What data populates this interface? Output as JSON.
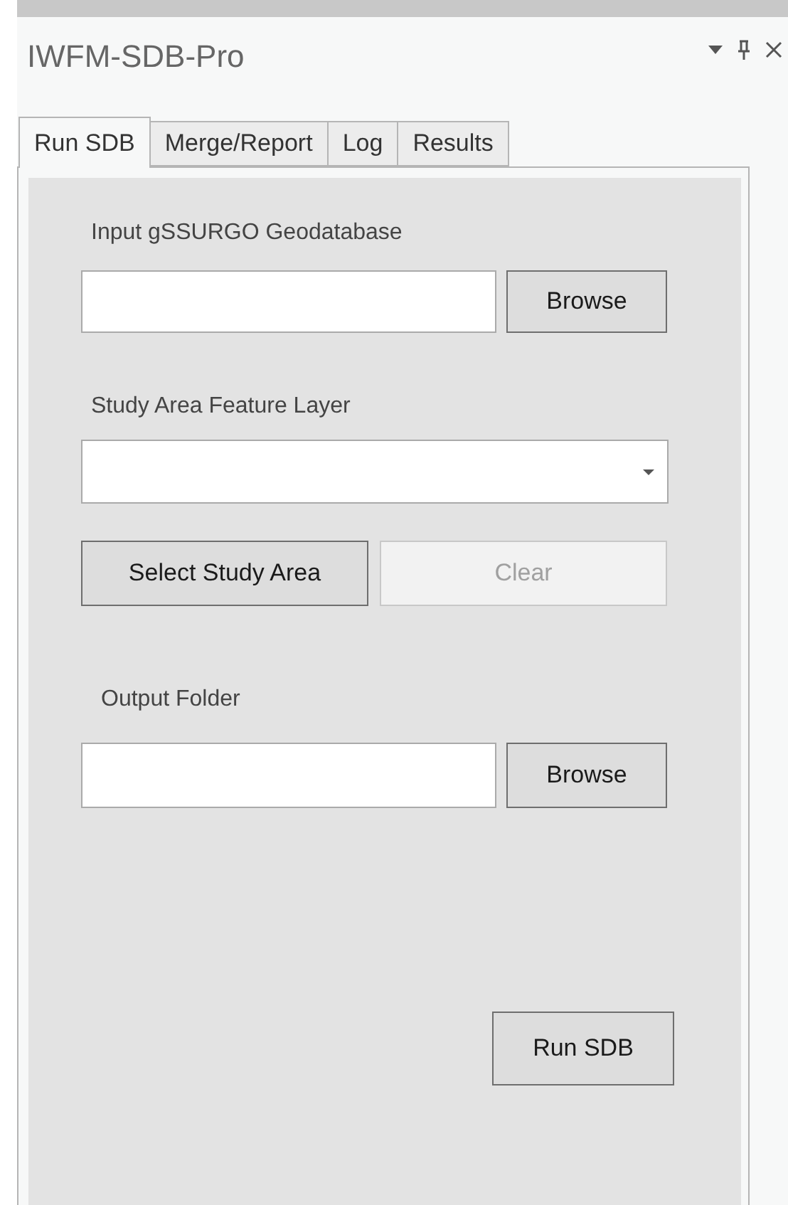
{
  "pane": {
    "title": "IWFM-SDB-Pro"
  },
  "tabs": [
    {
      "label": "Run SDB",
      "selected": true
    },
    {
      "label": "Merge/Report",
      "selected": false
    },
    {
      "label": "Log",
      "selected": false
    },
    {
      "label": "Results",
      "selected": false
    }
  ],
  "form": {
    "geodatabase": {
      "label": "Input gSSURGO Geodatabase",
      "button": "Browse"
    },
    "study_area": {
      "label": "Study Area Feature Layer",
      "buttons": [
        {
          "label": "Select Study Area",
          "disabled": false
        },
        {
          "label": "Clear",
          "disabled": true
        }
      ]
    },
    "output": {
      "label": "Output Folder",
      "button": "Browse"
    },
    "run_button": "Run SDB"
  }
}
